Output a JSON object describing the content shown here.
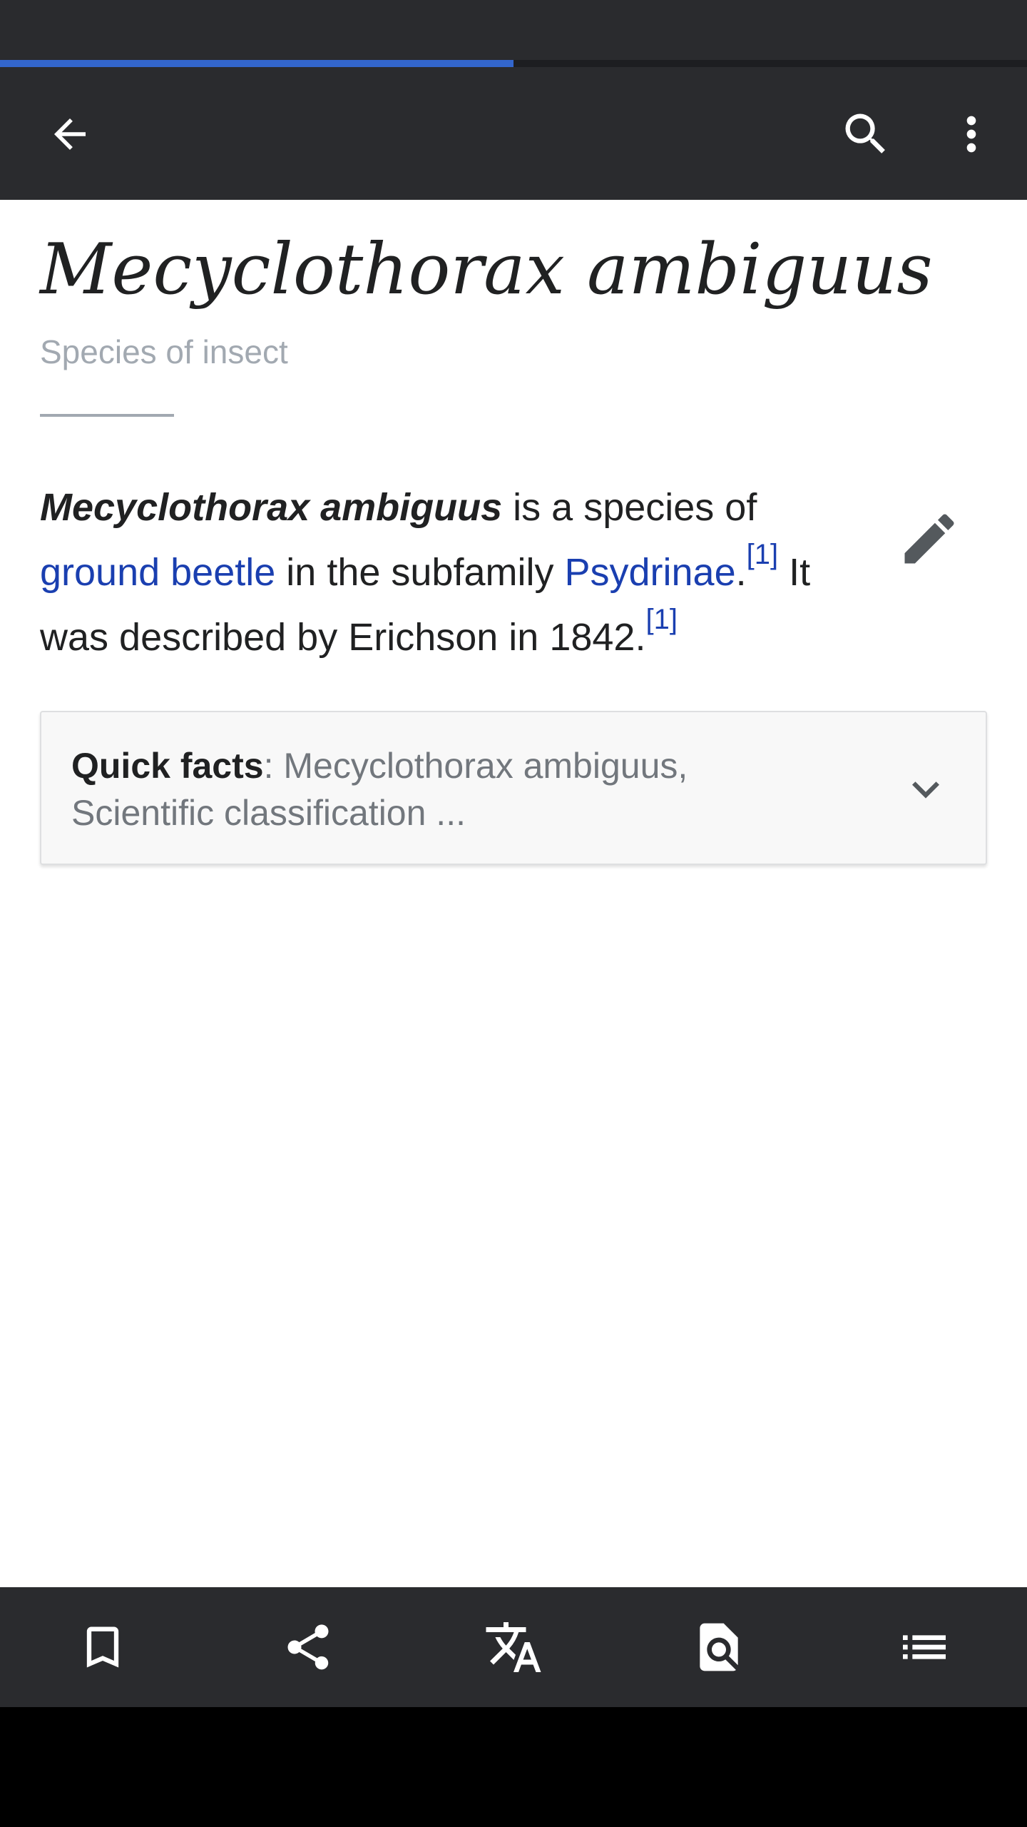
{
  "loading_progress": 0.5,
  "colors": {
    "toolbar_bg": "#2a2b2e",
    "progress_accent": "#3366cc",
    "link": "#1a3fb0",
    "text": "#202122",
    "muted": "#a2a9b1"
  },
  "toolbar": {
    "back_icon": "arrow-left-icon",
    "search_icon": "search-icon",
    "overflow_icon": "more-vertical-icon"
  },
  "article": {
    "title": "Mecyclothorax ambiguus",
    "description": "Species of insect",
    "lead": {
      "subject": "Mecyclothorax ambiguus",
      "text_1": " is a species of ",
      "link_1": "ground beetle",
      "text_2": " in the subfamily ",
      "link_2": "Psydrinae",
      "text_3": ".",
      "ref_1": "[1]",
      "text_4": " It was described by Erichson in 1842.",
      "ref_2": "[1]"
    },
    "edit_icon": "pencil-icon"
  },
  "quick_facts": {
    "label": "Quick facts",
    "separator": ": ",
    "summary": "Mecyclothorax ambiguus, Scientific classification ...",
    "chevron_icon": "chevron-down-icon"
  },
  "bottom_bar": {
    "items": [
      {
        "icon": "bookmark-icon"
      },
      {
        "icon": "share-icon"
      },
      {
        "icon": "translate-icon"
      },
      {
        "icon": "find-in-page-icon"
      },
      {
        "icon": "table-of-contents-icon"
      }
    ]
  }
}
